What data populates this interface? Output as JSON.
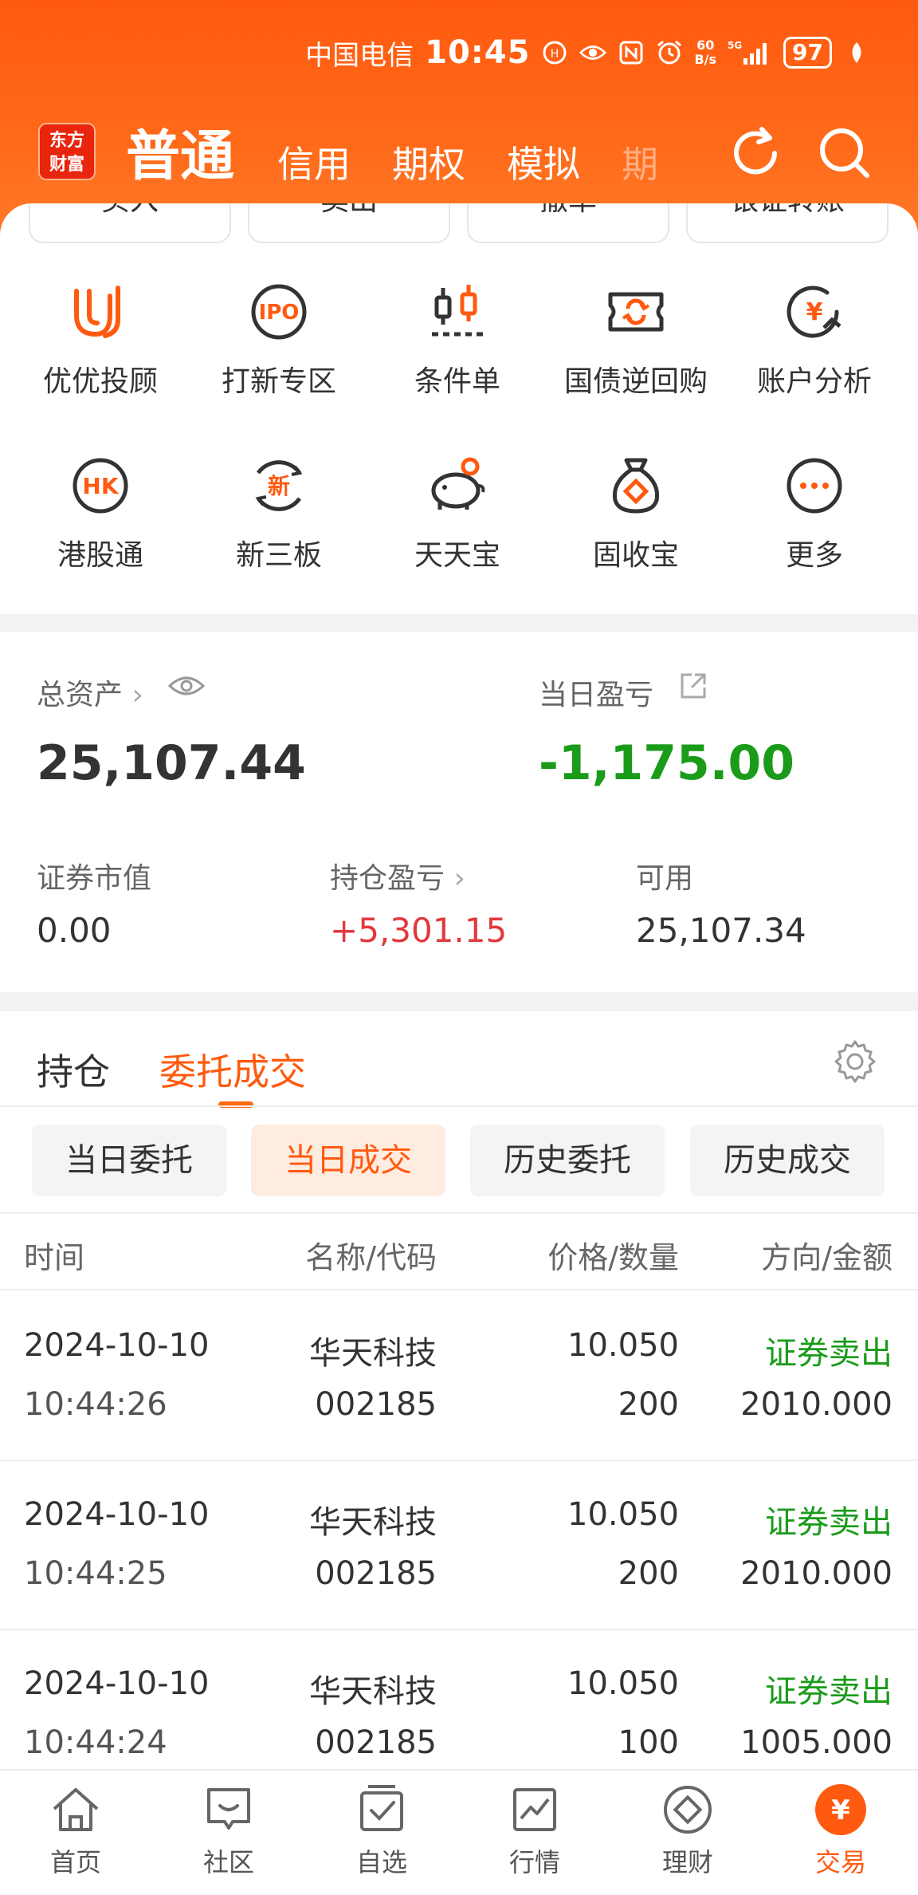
{
  "status": {
    "carrier": "中国电信",
    "time": "10:45",
    "speed_top": "60",
    "speed_bottom": "B/s",
    "net": "5G",
    "battery": "97"
  },
  "header": {
    "logo": "东方财富",
    "tabs": [
      "普通",
      "信用",
      "期权",
      "模拟",
      "期"
    ]
  },
  "quick_actions": [
    "买入",
    "卖出",
    "撤单",
    "银证转账"
  ],
  "grid": [
    {
      "label": "优优投顾",
      "icon": "uu-icon"
    },
    {
      "label": "打新专区",
      "icon": "ipo-icon"
    },
    {
      "label": "条件单",
      "icon": "candlestick-icon"
    },
    {
      "label": "国债逆回购",
      "icon": "repo-icon"
    },
    {
      "label": "账户分析",
      "icon": "yuan-analysis-icon"
    },
    {
      "label": "港股通",
      "icon": "hk-icon",
      "badge": "HK"
    },
    {
      "label": "新三板",
      "icon": "neeq-icon",
      "badge": "新"
    },
    {
      "label": "天天宝",
      "icon": "piggy-bank-icon"
    },
    {
      "label": "固收宝",
      "icon": "money-bag-icon"
    },
    {
      "label": "更多",
      "icon": "more-icon"
    }
  ],
  "assets": {
    "total_label": "总资产",
    "total_value": "25,107.44",
    "daily_label": "当日盈亏",
    "daily_value": "-1,175.00",
    "market_label": "证券市值",
    "market_value": "0.00",
    "position_label": "持仓盈亏",
    "position_value": "+5,301.15",
    "avail_label": "可用",
    "avail_value": "25,107.34"
  },
  "tabs": {
    "holdings": "持仓",
    "orders": "委托成交"
  },
  "filters": [
    "当日委托",
    "当日成交",
    "历史委托",
    "历史成交"
  ],
  "table": {
    "headers": [
      "时间",
      "名称/代码",
      "价格/数量",
      "方向/金额"
    ],
    "rows": [
      {
        "date": "2024-10-10",
        "time": "10:44:26",
        "name": "华天科技",
        "code": "002185",
        "price": "10.050",
        "qty": "200",
        "dir": "证券卖出",
        "amount": "2010.000"
      },
      {
        "date": "2024-10-10",
        "time": "10:44:25",
        "name": "华天科技",
        "code": "002185",
        "price": "10.050",
        "qty": "200",
        "dir": "证券卖出",
        "amount": "2010.000"
      },
      {
        "date": "2024-10-10",
        "time": "10:44:24",
        "name": "华天科技",
        "code": "002185",
        "price": "10.050",
        "qty": "100",
        "dir": "证券卖出",
        "amount": "1005.000"
      }
    ]
  },
  "bottom_nav": [
    {
      "label": "首页",
      "icon": "home-icon"
    },
    {
      "label": "社区",
      "icon": "community-icon"
    },
    {
      "label": "自选",
      "icon": "watchlist-icon"
    },
    {
      "label": "行情",
      "icon": "market-chart-icon"
    },
    {
      "label": "理财",
      "icon": "finance-diamond-icon"
    },
    {
      "label": "交易",
      "icon": "trade-yuan-icon",
      "glyph": "¥"
    }
  ],
  "colors": {
    "brand": "#ff5a10",
    "loss": "#1a9b1a",
    "gain": "#e0393e"
  }
}
